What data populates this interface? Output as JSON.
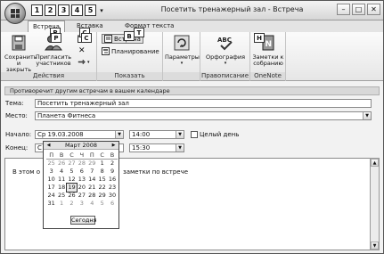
{
  "window": {
    "title": "Посетить тренажерный зал - Встреча"
  },
  "quick_access": {
    "keytips": [
      "1",
      "2",
      "3",
      "4",
      "5"
    ]
  },
  "ribbon_tabs": [
    {
      "label": "Встреча",
      "keytip": "Р"
    },
    {
      "label": "Вставка",
      "keytip": "С"
    },
    {
      "label": "Формат текста",
      "keytip": "Т"
    }
  ],
  "ribbon": {
    "groups": [
      {
        "label": "Действия"
      },
      {
        "label": "Показать"
      },
      {
        "label": ""
      },
      {
        "label": "Правописание"
      },
      {
        "label": "OneNote"
      }
    ],
    "buttons": {
      "save_close": "Сохранить и закрыть",
      "invite": "Пригласить участников",
      "meeting": "Встреча",
      "planning": "Планирование",
      "params": "Параметры",
      "spelling": "Орфография",
      "notes": "Заметки к собранию"
    },
    "keytips": {
      "b": "В",
      "p": "Р",
      "s": "С",
      "n": "Н"
    }
  },
  "infobar": {
    "text": "Противоречит другим встречам в вашем календаре"
  },
  "form": {
    "subject_label": "Тема:",
    "subject_value": "Посетить тренажерный зал",
    "location_label": "Место:",
    "location_value": "Планета Фитнеса",
    "start_label": "Начало:",
    "start_date": "Ср 19.03.2008",
    "start_time": "14:00",
    "allday_label": "Целый день",
    "end_label": "Конец:",
    "end_date": "С",
    "end_time": "15:30"
  },
  "body": {
    "text_left": "В этом о",
    "text_right": "заметки по встрече"
  },
  "calendar": {
    "month": "Март 2008",
    "weekdays": [
      "П",
      "В",
      "С",
      "Ч",
      "П",
      "С",
      "В"
    ],
    "weeks": [
      [
        "25",
        "26",
        "27",
        "28",
        "29",
        "1",
        "2"
      ],
      [
        "3",
        "4",
        "5",
        "6",
        "7",
        "8",
        "9"
      ],
      [
        "10",
        "11",
        "12",
        "13",
        "14",
        "15",
        "16"
      ],
      [
        "17",
        "18",
        "19",
        "20",
        "21",
        "22",
        "23"
      ],
      [
        "24",
        "25",
        "26",
        "27",
        "28",
        "29",
        "30"
      ],
      [
        "31",
        "1",
        "2",
        "3",
        "4",
        "5",
        "6"
      ]
    ],
    "today_button": "Сегодня"
  }
}
